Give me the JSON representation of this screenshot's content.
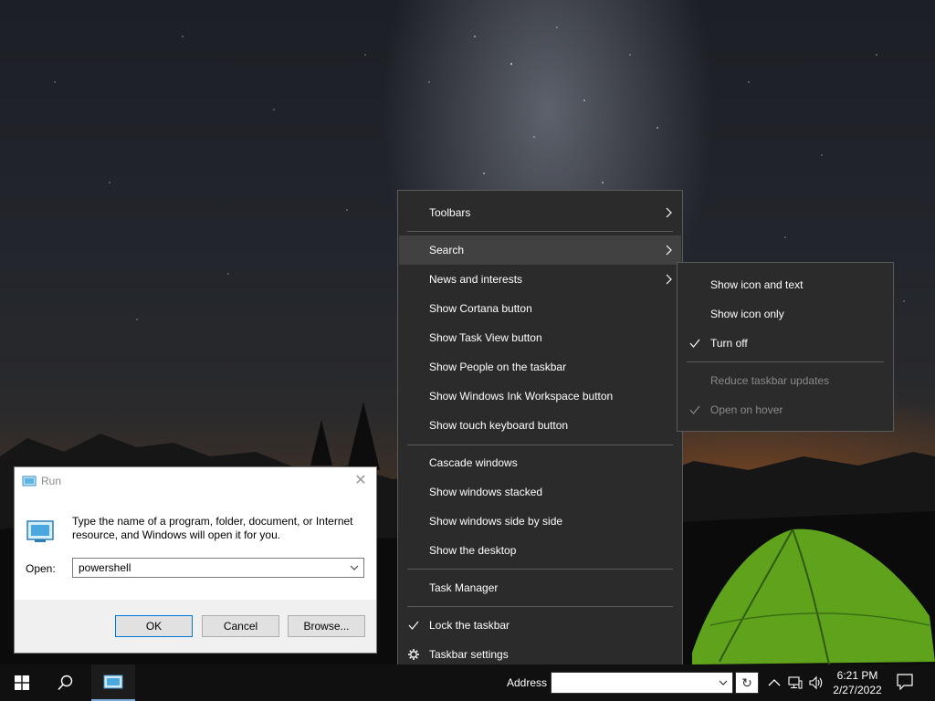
{
  "run_dialog": {
    "title": "Run",
    "description": "Type the name of a program, folder, document, or Internet resource, and Windows will open it for you.",
    "open_label": "Open:",
    "open_value": "powershell",
    "ok_label": "OK",
    "cancel_label": "Cancel",
    "browse_label": "Browse...",
    "close_glyph": "✕"
  },
  "context_menu": {
    "toolbars": "Toolbars",
    "search": "Search",
    "news_and_interests": "News and interests",
    "show_cortana": "Show Cortana button",
    "show_task_view": "Show Task View button",
    "show_people": "Show People on the taskbar",
    "show_ink_workspace": "Show Windows Ink Workspace button",
    "show_touch_keyboard": "Show touch keyboard button",
    "cascade": "Cascade windows",
    "stacked": "Show windows stacked",
    "side_by_side": "Show windows side by side",
    "show_desktop": "Show the desktop",
    "task_manager": "Task Manager",
    "lock_taskbar": "Lock the taskbar",
    "lock_taskbar_checked": true,
    "taskbar_settings": "Taskbar settings",
    "highlighted_item": "Search"
  },
  "news_submenu": {
    "show_icon_and_text": "Show icon and text",
    "show_icon_only": "Show icon only",
    "turn_off": "Turn off",
    "turn_off_checked": true,
    "reduce_updates": "Reduce taskbar updates",
    "open_on_hover": "Open on hover",
    "open_on_hover_checked": true
  },
  "taskbar": {
    "address_label": "Address",
    "go_glyph": "↻",
    "time": "6:21 PM",
    "date": "2/27/2022",
    "accent_color": "#7aa9d9"
  },
  "icons": {
    "start": "windows-logo-icon",
    "search": "search-icon",
    "run_app": "run-app-icon",
    "tray": [
      "chevron-up-icon",
      "network-icon",
      "volume-icon"
    ],
    "notifications": "action-center-icon"
  }
}
